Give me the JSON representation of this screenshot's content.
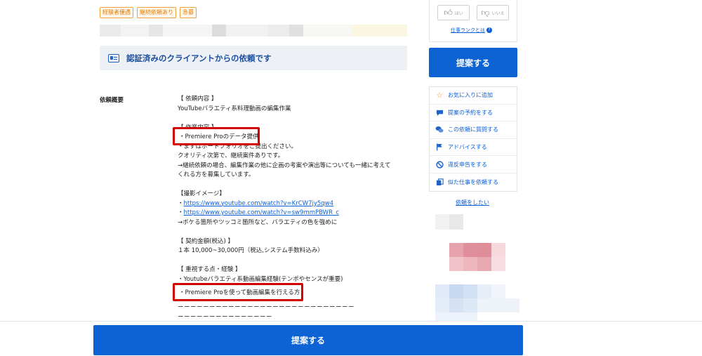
{
  "badges": [
    "経験者優遇",
    "継続依頼あり",
    "急募"
  ],
  "verified_banner": {
    "text": "認証済みのクライアントからの依頼です",
    "icon": "id-card-icon"
  },
  "description": {
    "label": "依頼概要",
    "lines": [
      "【 依頼内容 】",
      "YouTubeバラエティ系料理動画の編集作業",
      "",
      "【 作業内容 】",
      "・Premiere Proのデータ提供",
      "・まずはポートフォリオをご提出ください。",
      "クオリティ次第で、継続案件ありです。",
      "→継続依頼の場合、編集作業の他に企画の考案や演出等についても一緒に考えて",
      "くれる方を募集しています。",
      "",
      "【撮影イメージ】",
      "・",
      "・",
      "→ボケる箇所やツッコミ箇所など、バラエティの色を強めに",
      "",
      "【 契約金額(税込) 】",
      "１本 10,000~30,000円（税込,システム手数料込み）",
      "",
      "【 重視する点・経験 】",
      "・Youtubeバラエティ系動画編集経験(テンポやセンスが重要)",
      "・Premiere Proを使って動画編集を行える方",
      "",
      "ーーーーーーーーーーーーーーーーーーーーーーーーーーーー",
      "ーーーーーーーーーーーーーーー"
    ],
    "links": [
      "https://www.youtube.com/watch?v=KrCW7jy5qw4",
      "https://www.youtube.com/watch?v=sw9mmPBWR_c"
    ],
    "highlight_1": "・Premiere Proのデータ提供",
    "highlight_2": "・Premiere Proを使って動画編集を行える方"
  },
  "vote": {
    "yes_label": "はい",
    "no_label": "いいえ",
    "rank_link": "仕事ランクとは"
  },
  "propose_side_label": "提案する",
  "actions": [
    {
      "label": "お気に入りに追加",
      "icon": "star-icon"
    },
    {
      "label": "提案の予約をする",
      "icon": "bookmark-bubble-icon"
    },
    {
      "label": "この依頼に質問する",
      "icon": "chat-bubbles-icon"
    },
    {
      "label": "アドバイスする",
      "icon": "flag-icon"
    },
    {
      "label": "違反申告をする",
      "icon": "prohibited-icon"
    },
    {
      "label": "似た仕事を依頼する",
      "icon": "copy-icon"
    }
  ],
  "request_link": "依頼をしたい",
  "propose_bottom_label": "提案する",
  "colors": {
    "primary": "#0d63d4",
    "highlight_border": "#d40000",
    "badge": "#e07b00",
    "banner_bg": "#edf1f6"
  }
}
